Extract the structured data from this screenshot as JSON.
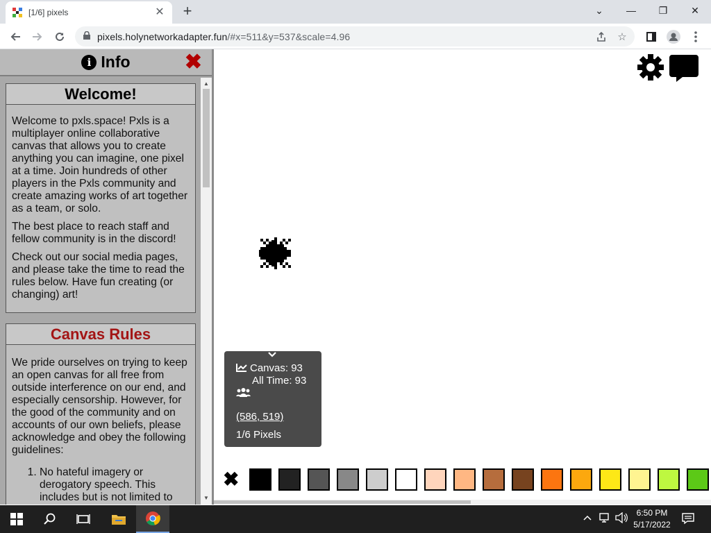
{
  "browser": {
    "tab_title": "[1/6] pixels",
    "tab_close": "✕",
    "new_tab": "+",
    "url_host": "pixels.holynetworkadapter.fun",
    "url_rest": "/#x=511&y=537&scale=4.96",
    "window_controls": [
      "⌄",
      "—",
      "❐",
      "✕"
    ]
  },
  "info_panel": {
    "title": "Info",
    "close_label": "✖",
    "welcome": {
      "heading": "Welcome!",
      "paragraphs": [
        "Welcome to pxls.space! Pxls is a multiplayer online collaborative canvas that allows you to create anything you can imagine, one pixel at a time. Join hundreds of other players in the Pxls community and create amazing works of art together as a team, or solo.",
        "The best place to reach staff and fellow community is in the discord!",
        "Check out our social media pages, and please take the time to read the rules below. Have fun creating (or changing) art!"
      ]
    },
    "rules": {
      "heading": "Canvas Rules",
      "heading_color": "#a31515",
      "intro": "We pride ourselves on trying to keep an open canvas for all free from outside interference on our end, and especially censorship. However, for the good of the community and on accounts of our own beliefs, please acknowledge and obey the following guidelines:",
      "items": [
        "No hateful imagery or derogatory speech. This includes but is not limited to"
      ]
    }
  },
  "stats": {
    "canvas_label": "Canvas: 93",
    "alltime_label": "All Time: 93",
    "coords": "(586, 519)",
    "pixels": "1/6 Pixels"
  },
  "palette": {
    "close_label": "✖",
    "colors": [
      "#000000",
      "#222222",
      "#555555",
      "#888888",
      "#cdcdcd",
      "#ffffff",
      "#ffd5bc",
      "#ffb783",
      "#b66d3d",
      "#77431f",
      "#fc7510",
      "#fca80e",
      "#fde817",
      "#fff491",
      "#bef840",
      "#5cc917"
    ]
  },
  "taskbar": {
    "time": "6:50 PM",
    "date": "5/17/2022"
  }
}
